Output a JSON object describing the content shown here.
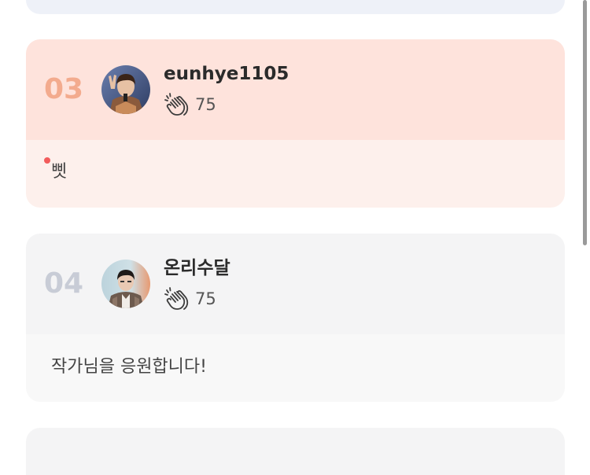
{
  "ranking": [
    {
      "rank": "03",
      "username": "eunhye1105",
      "claps": "75",
      "comment": "삣",
      "has_new": true,
      "avatar_icon": "user-avatar-photo",
      "accent": "#f3ab8e"
    },
    {
      "rank": "04",
      "username": "온리수달",
      "claps": "75",
      "comment": "작가님을 응원합니다!",
      "has_new": false,
      "avatar_icon": "user-avatar-photo",
      "accent": "#c8ccd6"
    }
  ],
  "icons": {
    "clap": "clapping-hands-icon"
  },
  "colors": {
    "highlight_head": "#fee3dc",
    "highlight_body": "#fdf0ec",
    "normal_head": "#f4f4f5",
    "normal_body": "#f8f8f8",
    "new_dot": "#f25b5b"
  }
}
